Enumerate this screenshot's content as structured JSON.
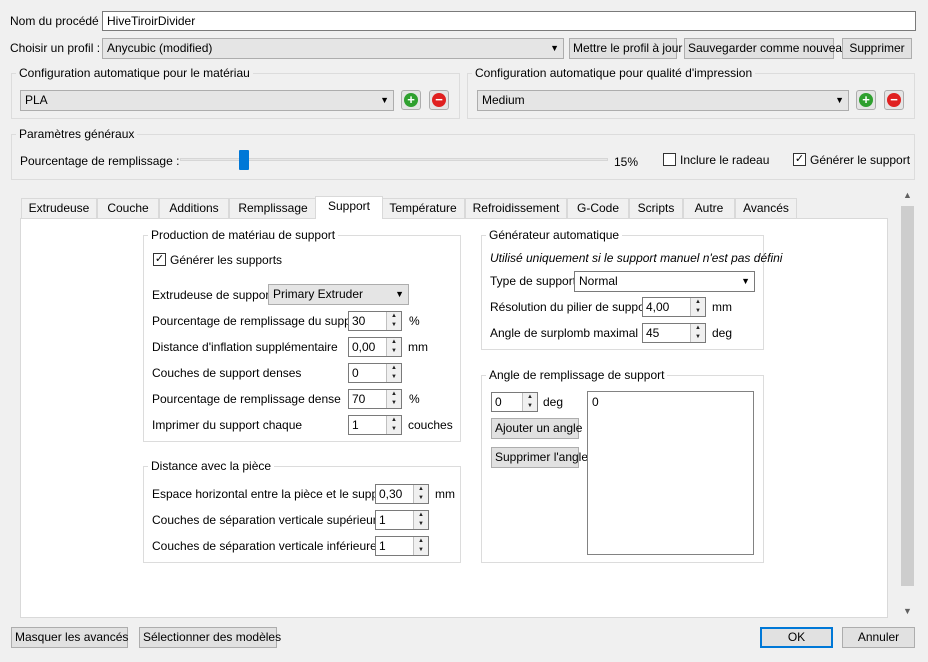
{
  "header": {
    "process_name_label": "Nom du procédé :",
    "process_name_value": "HiveTiroirDivider",
    "profile_label": "Choisir un profil :",
    "profile_value": "Anycubic (modified)",
    "update_profile_button": "Mettre le profil à jour",
    "save_as_new_button": "Sauvegarder comme nouveau",
    "delete_button": "Supprimer"
  },
  "material_config": {
    "title": "Configuration automatique pour le matériau",
    "value": "PLA",
    "add_icon": "plus-circle-icon",
    "remove_icon": "minus-circle-icon"
  },
  "quality_config": {
    "title": "Configuration automatique pour qualité d'impression",
    "value": "Medium",
    "add_icon": "plus-circle-icon",
    "remove_icon": "minus-circle-icon"
  },
  "general": {
    "title": "Paramètres généraux",
    "infill_label": "Pourcentage de remplissage :",
    "infill_percent": 15,
    "infill_value_text": "15%",
    "raft_label": "Inclure le radeau",
    "raft_checked": false,
    "support_label": "Générer le support",
    "support_checked": true
  },
  "tabs": [
    {
      "label": "Extrudeuse",
      "active": false
    },
    {
      "label": "Couche",
      "active": false
    },
    {
      "label": "Additions",
      "active": false
    },
    {
      "label": "Remplissage",
      "active": false
    },
    {
      "label": "Support",
      "active": true
    },
    {
      "label": "Température",
      "active": false
    },
    {
      "label": "Refroidissement",
      "active": false
    },
    {
      "label": "G-Code",
      "active": false
    },
    {
      "label": "Scripts",
      "active": false
    },
    {
      "label": "Autre",
      "active": false
    },
    {
      "label": "Avancés",
      "active": false
    }
  ],
  "support_material": {
    "title": "Production de matériau de support",
    "generate_label": "Générer les supports",
    "generate_checked": true,
    "extruder_label": "Extrudeuse de support",
    "extruder_value": "Primary Extruder",
    "infill_label": "Pourcentage de remplissage du support",
    "infill_value": "30",
    "infill_unit": "%",
    "inflation_label": "Distance d'inflation supplémentaire",
    "inflation_value": "0,00",
    "inflation_unit": "mm",
    "dense_layers_label": "Couches de support denses",
    "dense_layers_value": "0",
    "dense_infill_label": "Pourcentage de remplissage dense",
    "dense_infill_value": "70",
    "dense_infill_unit": "%",
    "every_label": "Imprimer du support chaque",
    "every_value": "1",
    "every_unit": "couches"
  },
  "distance_part": {
    "title": "Distance avec la pièce",
    "horizontal_label": "Espace horizontal entre la pièce et le support",
    "horizontal_value": "0,30",
    "horizontal_unit": "mm",
    "upper_label": "Couches de séparation verticale supérieure",
    "upper_value": "1",
    "lower_label": "Couches de séparation verticale inférieure",
    "lower_value": "1"
  },
  "auto_generator": {
    "title": "Générateur automatique",
    "note": "Utilisé uniquement si le support manuel n'est pas défini",
    "type_label": "Type de support",
    "type_value": "Normal",
    "pillar_label": "Résolution du pilier de support",
    "pillar_value": "4,00",
    "pillar_unit": "mm",
    "overhang_label": "Angle de surplomb maximal",
    "overhang_value": "45",
    "overhang_unit": "deg"
  },
  "infill_angle": {
    "title": "Angle de remplissage de support",
    "angle_value": "0",
    "angle_unit": "deg",
    "add_button": "Ajouter un angle",
    "remove_button": "Supprimer l'angle",
    "list": [
      "0"
    ]
  },
  "footer": {
    "hide_advanced_button": "Masquer les avancés",
    "select_models_button": "Sélectionner des modèles",
    "ok_button": "OK",
    "cancel_button": "Annuler"
  }
}
